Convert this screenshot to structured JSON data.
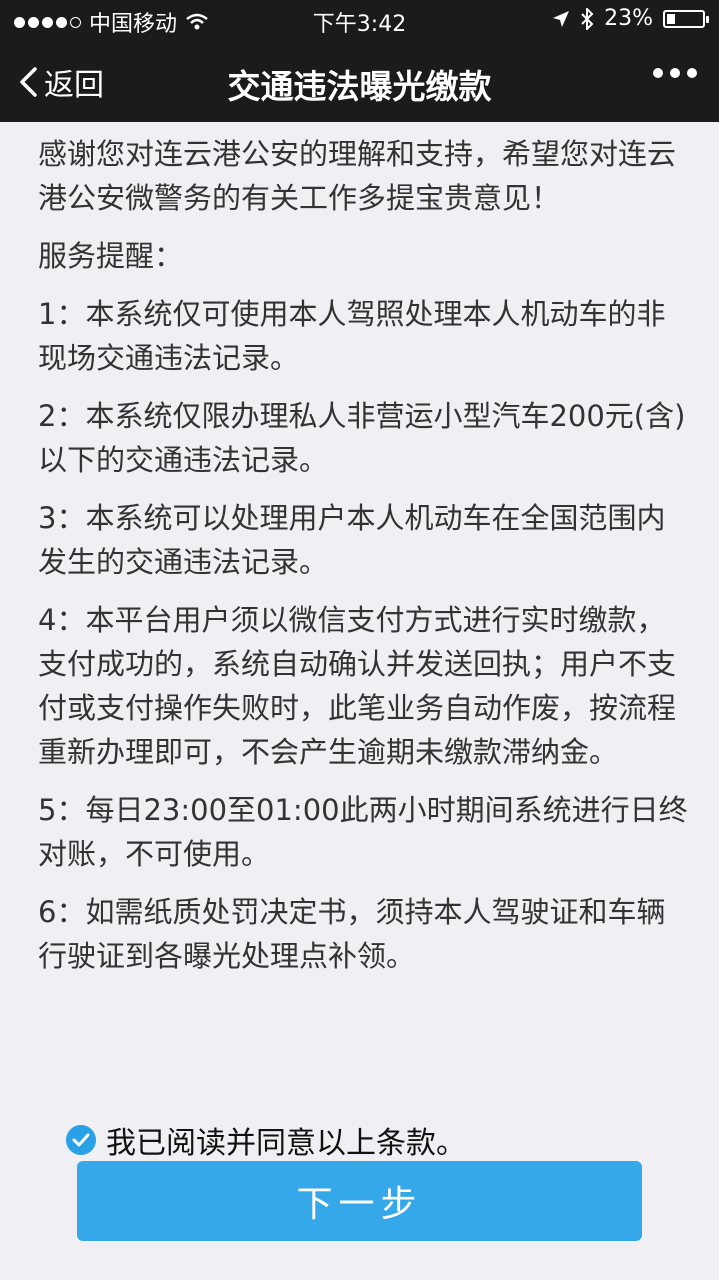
{
  "status_bar": {
    "carrier": "中国移动",
    "time": "下午3:42",
    "battery": "23%",
    "battery_level": 0.23,
    "icons": [
      "signal-dots",
      "wifi-icon",
      "location-icon",
      "bluetooth-icon",
      "battery-icon"
    ]
  },
  "nav": {
    "back_label": "返回",
    "title": "交通违法曝光缴款",
    "more_icon": "more-dots-icon"
  },
  "content": {
    "intro": "感谢您对连云港公安的理解和支持，希望您对连云港公安微警务的有关工作多提宝贵意见！",
    "reminder_title": "服务提醒：",
    "items": [
      "1：本系统仅可使用本人驾照处理本人机动车的非现场交通违法记录。",
      "2：本系统仅限办理私人非营运小型汽车200元(含)以下的交通违法记录。",
      "3：本系统可以处理用户本人机动车在全国范围内发生的交通违法记录。",
      "4：本平台用户须以微信支付方式进行实时缴款，支付成功的，系统自动确认并发送回执；用户不支付或支付操作失败时，此笔业务自动作废，按流程重新办理即可，不会产生逾期未缴款滞纳金。",
      "5：每日23:00至01:00此两小时期间系统进行日终对账，不可使用。",
      "6：如需纸质处罚决定书，须持本人驾驶证和车辆行驶证到各曝光处理点补领。"
    ]
  },
  "agreement": {
    "label": "我已阅读并同意以上条款。",
    "checked": true
  },
  "next_button": {
    "label": "下一步"
  },
  "colors": {
    "bar_bg": "#1b1b1e",
    "page_bg": "#efeff4",
    "accent": "#35a8ea",
    "check": "#2aa0e6"
  }
}
